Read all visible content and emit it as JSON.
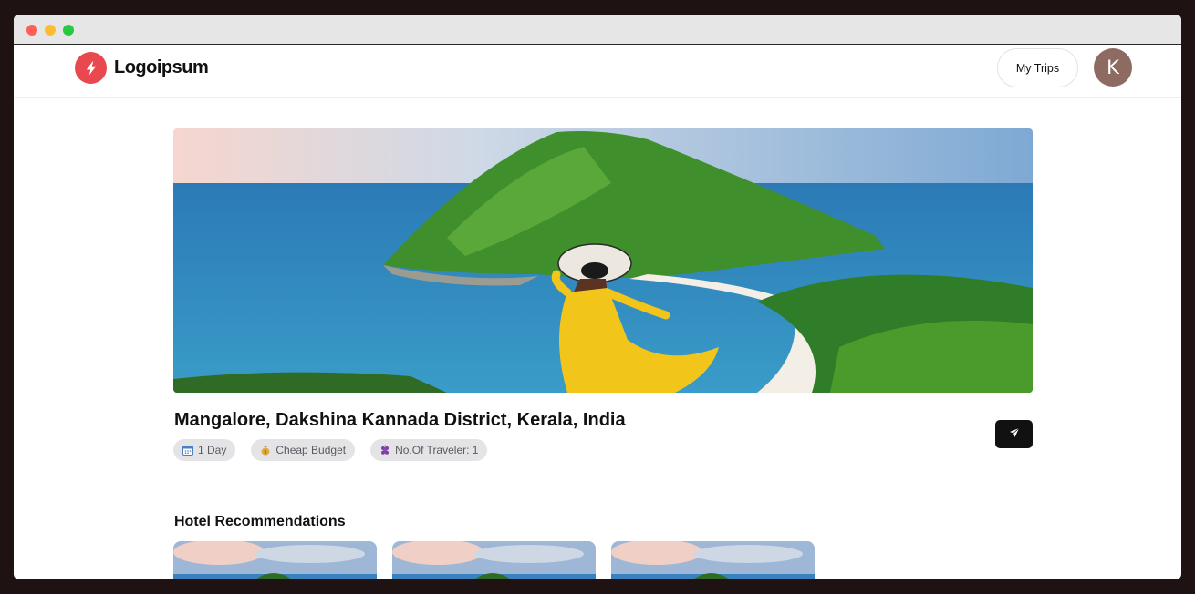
{
  "window": {
    "controls": [
      "close",
      "minimize",
      "maximize"
    ]
  },
  "navbar": {
    "logo_text": "Logoipsum",
    "logo_icon": "bolt-icon",
    "my_trips_label": "My Trips",
    "avatar_initial": "K"
  },
  "trip": {
    "location": "Mangalore, Dakshina Kannada District, Kerala, India",
    "chips": [
      {
        "icon": "calendar-icon",
        "label": "1 Day"
      },
      {
        "icon": "money-bag-icon",
        "label": "Cheap Budget"
      },
      {
        "icon": "grapes-icon",
        "label": "No.Of Traveler: 1"
      }
    ],
    "share_icon": "send-icon"
  },
  "hotels": {
    "section_title": "Hotel Recommendations",
    "cards": [
      {},
      {},
      {}
    ]
  },
  "colors": {
    "brand": "#e8484e",
    "avatar": "#8d6b60",
    "dark_button": "#111111",
    "chip_bg": "#e4e4e7"
  }
}
